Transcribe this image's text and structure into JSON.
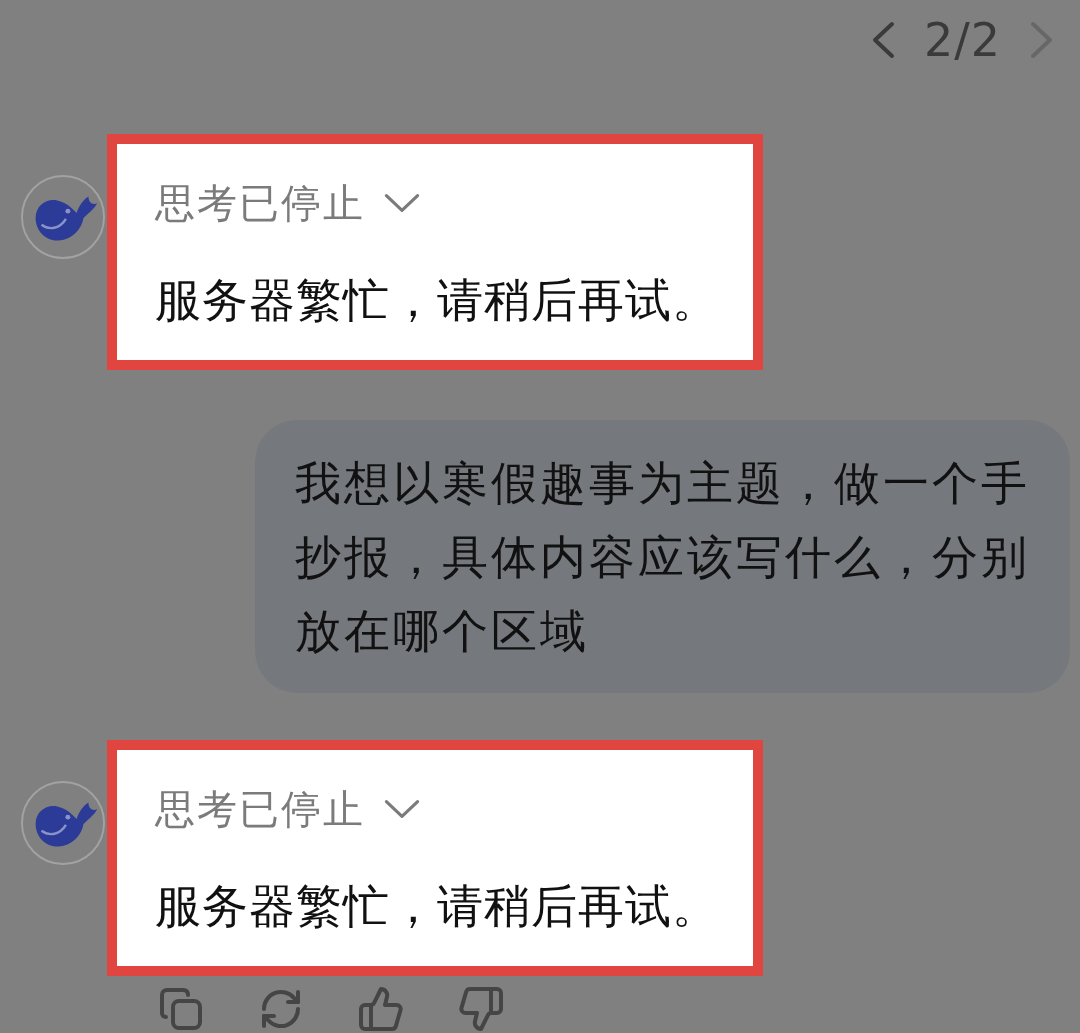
{
  "pager": {
    "label": "2/2",
    "prev": {
      "disabled": false
    },
    "next": {
      "disabled": true
    }
  },
  "messages": [
    {
      "kind": "assistant",
      "highlighted": true,
      "thinking": {
        "label": "思考已停止",
        "expanded": false
      },
      "text": "服务器繁忙，请稍后再试。"
    },
    {
      "kind": "user",
      "text": "我想以寒假趣事为主题，做一个手抄报，具体内容应该写什么，分别放在哪个区域"
    },
    {
      "kind": "assistant",
      "highlighted": true,
      "thinking": {
        "label": "思考已停止",
        "expanded": false
      },
      "text": "服务器繁忙，请稍后再试。",
      "actions": [
        {
          "kind": "copy"
        },
        {
          "kind": "regenerate"
        },
        {
          "kind": "like"
        },
        {
          "kind": "dislike"
        }
      ]
    }
  ]
}
